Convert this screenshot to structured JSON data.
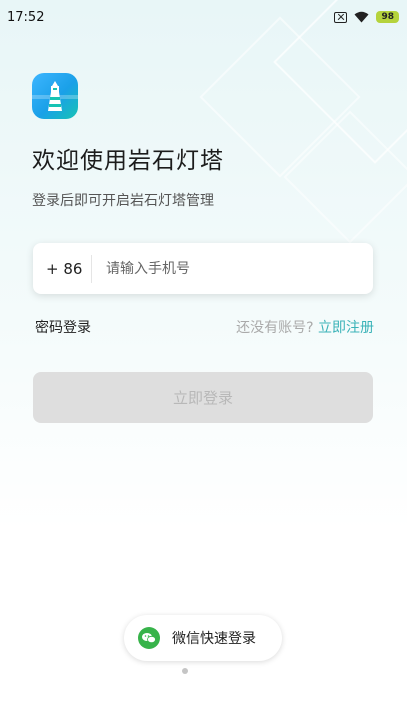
{
  "status_bar": {
    "time": "17:52",
    "battery": "98"
  },
  "app": {
    "title": "欢迎使用岩石灯塔",
    "subtitle": "登录后即可开启岩石灯塔管理"
  },
  "form": {
    "country_code": "+ 86",
    "phone_placeholder": "请输入手机号"
  },
  "links": {
    "password_login": "密码登录",
    "no_account": "还没有账号?",
    "register": "立即注册"
  },
  "login_button": "立即登录",
  "wechat_login": "微信快速登录",
  "colors": {
    "accent": "#3bb3b8",
    "wechat_green": "#37b34a",
    "disabled_button": "#dedede"
  }
}
